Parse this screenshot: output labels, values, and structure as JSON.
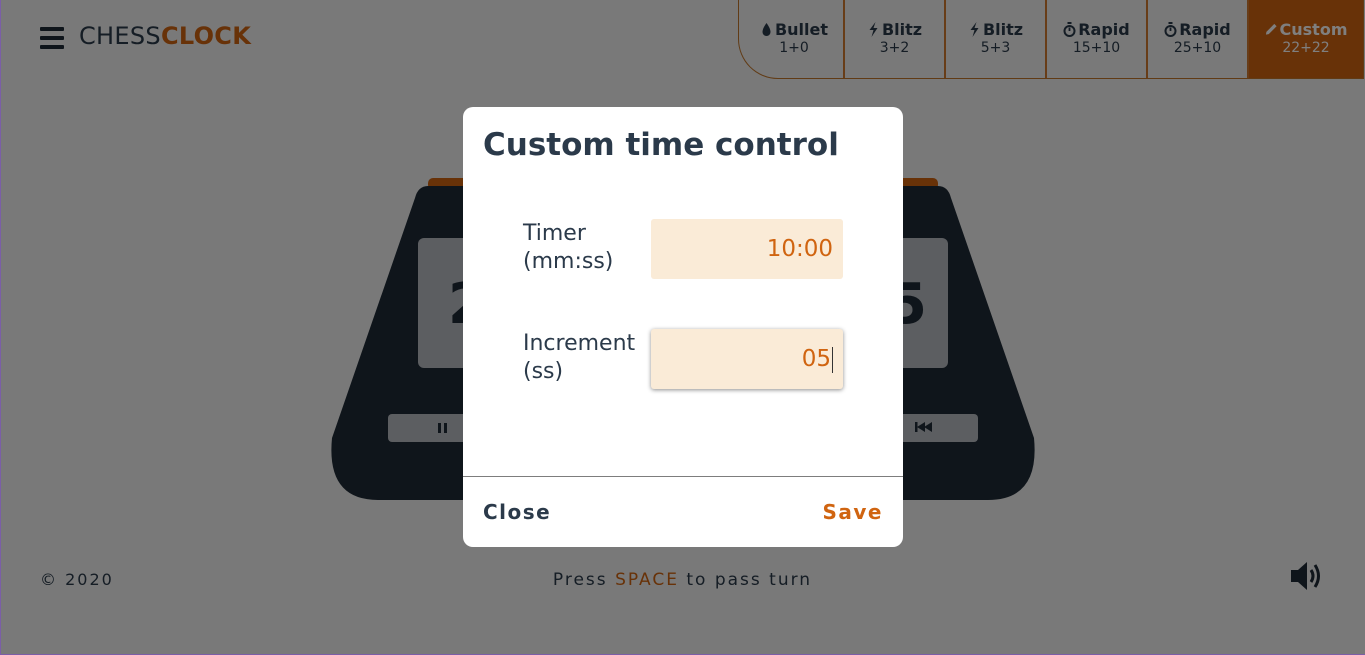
{
  "header": {
    "logo_part1": "CHESS",
    "logo_part2": "CLOCK",
    "tabs": [
      {
        "icon": "bullet-icon",
        "name": "Bullet",
        "value": "1+0"
      },
      {
        "icon": "lightning-icon",
        "name": "Blitz",
        "value": "3+2"
      },
      {
        "icon": "lightning-icon",
        "name": "Blitz",
        "value": "5+3"
      },
      {
        "icon": "stopwatch-icon",
        "name": "Rapid",
        "value": "15+10"
      },
      {
        "icon": "stopwatch-icon",
        "name": "Rapid",
        "value": "25+10"
      },
      {
        "icon": "pencil-icon",
        "name": "Custom",
        "value": "22+22",
        "active": true
      }
    ]
  },
  "modal": {
    "title": "Custom time control",
    "timer_label_1": "Timer",
    "timer_label_2": "(mm:ss)",
    "timer_value": "10:00",
    "increment_label_1": "Increment",
    "increment_label_2": "(ss)",
    "increment_value": "05",
    "close_label": "Close",
    "save_label": "Save"
  },
  "footer": {
    "copyright": "© 2020",
    "hint_prefix": "Press ",
    "hint_key": "SPACE",
    "hint_suffix": " to pass turn"
  },
  "colors": {
    "accent": "#d06410",
    "navy": "#2b3a4a",
    "field_bg": "#faebd7"
  }
}
